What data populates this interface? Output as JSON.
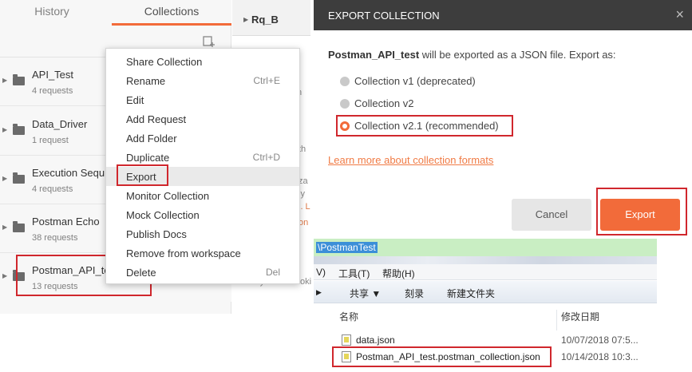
{
  "sidebar": {
    "tabs": {
      "history": "History",
      "collections": "Collections"
    },
    "collections": [
      {
        "name": "API_Test",
        "count": "4 requests"
      },
      {
        "name": "Data_Driver",
        "count": "1 request"
      },
      {
        "name": "Execution Sequ",
        "count": "4 requests"
      },
      {
        "name": "Postman Echo",
        "count": "38 requests"
      },
      {
        "name": "Postman_API_te",
        "count": "13 requests"
      }
    ]
  },
  "main": {
    "request_tab": "Rq_B",
    "fragments": {
      "a": "n",
      "b": "th",
      "c": "za",
      "d": "ly",
      "e": "i. L",
      "f": "on",
      "g": "Body",
      "h": "Cooki"
    }
  },
  "context_menu": {
    "items": [
      {
        "label": "Share Collection",
        "shortcut": ""
      },
      {
        "label": "Rename",
        "shortcut": "Ctrl+E"
      },
      {
        "label": "Edit",
        "shortcut": ""
      },
      {
        "label": "Add Request",
        "shortcut": ""
      },
      {
        "label": "Add Folder",
        "shortcut": ""
      },
      {
        "label": "Duplicate",
        "shortcut": "Ctrl+D"
      },
      {
        "label": "Export",
        "shortcut": ""
      },
      {
        "label": "Monitor Collection",
        "shortcut": ""
      },
      {
        "label": "Mock Collection",
        "shortcut": ""
      },
      {
        "label": "Publish Docs",
        "shortcut": ""
      },
      {
        "label": "Remove from workspace",
        "shortcut": ""
      },
      {
        "label": "Delete",
        "shortcut": "Del"
      }
    ]
  },
  "export_dialog": {
    "title": "EXPORT COLLECTION",
    "close": "×",
    "collection_name": "Postman_API_test",
    "description": " will be exported as a JSON file. Export as:",
    "options": [
      {
        "label": "Collection v1 (deprecated)",
        "checked": false
      },
      {
        "label": "Collection v2",
        "checked": false
      },
      {
        "label": "Collection v2.1 (recommended)",
        "checked": true
      }
    ],
    "learn_link": "Learn more about collection formats",
    "cancel": "Cancel",
    "export": "Export"
  },
  "explorer": {
    "address": "\\PostmanTest",
    "menu": {
      "view": "V)",
      "tools": "工具(T)",
      "help": "帮助(H)"
    },
    "commands": {
      "share": "共享 ▼",
      "burn": "刻录",
      "new_folder": "新建文件夹"
    },
    "columns": {
      "name": "名称",
      "modified": "修改日期"
    },
    "files": [
      {
        "name": "data.json",
        "date": "10/07/2018 07:5..."
      },
      {
        "name": "Postman_API_test.postman_collection.json",
        "date": "10/14/2018 10:3..."
      }
    ]
  },
  "colors": {
    "accent": "#f26b3a",
    "highlight_box": "#d0272d",
    "dialog_header": "#3d3d3d"
  }
}
